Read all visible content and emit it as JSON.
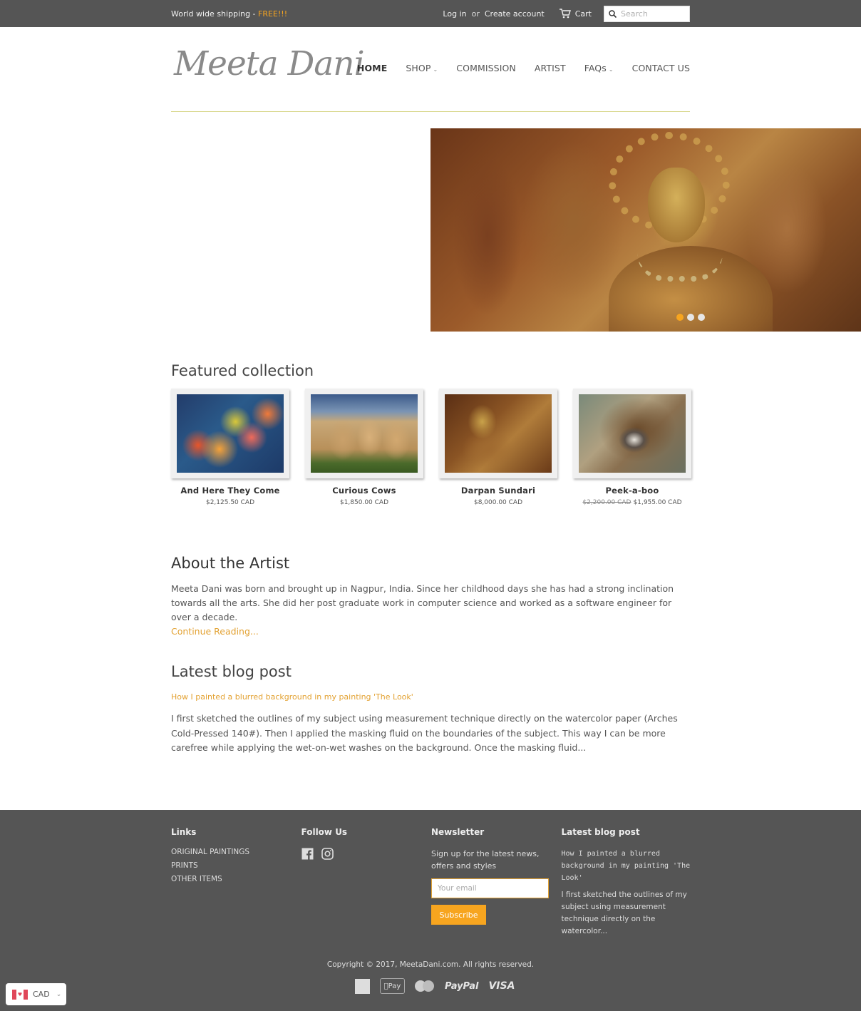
{
  "topbar": {
    "shipping_text": "World wide shipping - ",
    "shipping_highlight": "FREE!!!",
    "login": "Log in",
    "or": "or",
    "create_account": "Create account",
    "cart": "Cart",
    "search_placeholder": "Search"
  },
  "header": {
    "logo": "Meeta Dani",
    "nav": [
      {
        "label": "HOME",
        "active": true
      },
      {
        "label": "SHOP",
        "dropdown": true
      },
      {
        "label": "COMMISSION"
      },
      {
        "label": "ARTIST"
      },
      {
        "label": "FAQs",
        "dropdown": true
      },
      {
        "label": "CONTACT US"
      }
    ]
  },
  "hero": {
    "slides": 3,
    "active_slide": 1
  },
  "featured": {
    "title": "Featured collection",
    "products": [
      {
        "name": "And Here They Come",
        "price": "$2,125.50 CAD"
      },
      {
        "name": "Curious Cows",
        "price": "$1,850.00 CAD"
      },
      {
        "name": "Darpan Sundari",
        "price": "$8,000.00 CAD"
      },
      {
        "name": "Peek-a-boo",
        "compare_price": "$2,200.00 CAD",
        "price": "$1,955.00 CAD"
      }
    ]
  },
  "about": {
    "title": "About the Artist",
    "text": "Meeta Dani was born and brought up in Nagpur, India. Since her childhood days she has had a strong inclination towards all the arts. She did her post graduate work in computer science and worked as a software engineer for over a decade.",
    "link": "Continue Reading..."
  },
  "blog": {
    "title": "Latest blog post",
    "post_title": "How I painted a blurred background in my painting 'The Look'",
    "excerpt": "I first sketched the outlines of my subject using measurement technique directly on the watercolor paper (Arches Cold-Pressed 140#). Then I applied the masking  fluid on the boundaries of the subject. This way I can be more carefree while applying the wet-on-wet washes on the background. Once the masking fluid..."
  },
  "footer": {
    "links_title": "Links",
    "links": [
      "ORIGINAL PAINTINGS",
      "PRINTS",
      "OTHER ITEMS"
    ],
    "follow_title": "Follow Us",
    "social": [
      "facebook",
      "instagram"
    ],
    "newsletter_title": "Newsletter",
    "newsletter_text": "Sign up for the latest news, offers and styles",
    "email_placeholder": "Your email",
    "subscribe": "Subscribe",
    "blog_title": "Latest blog post",
    "blog_post_title": "How I painted a blurred background in my painting 'The Look'",
    "blog_excerpt": "I first sketched the outlines of my subject using measurement technique directly on the watercolor...",
    "copyright": "Copyright © 2017, MeetaDani.com. All rights reserved.",
    "payments": {
      "apple": "Pay",
      "paypal": "PayPal",
      "visa": "VISA"
    }
  },
  "currency": {
    "code": "CAD"
  },
  "colors": {
    "accent": "#f7a51f",
    "link_gold": "#e3a233",
    "bar_gray": "#555555"
  }
}
